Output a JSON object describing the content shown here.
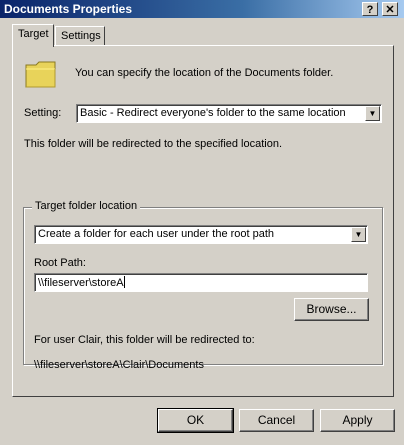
{
  "window": {
    "title": "Documents Properties",
    "help_label": "?",
    "close_label": "✕"
  },
  "tabs": [
    {
      "label": "Target"
    },
    {
      "label": "Settings"
    }
  ],
  "target": {
    "intro_text": "You can specify the location of the Documents folder.",
    "setting_label": "Setting:",
    "setting_value": "Basic - Redirect everyone's folder to the same location",
    "redirect_note": "This folder will be redirected to the specified location.",
    "group_title": "Target folder location",
    "location_value": "Create a folder for each user under the root path",
    "root_path_label": "Root Path:",
    "root_path_value": "\\\\fileserver\\storeA",
    "browse_label": "Browse...",
    "example_text": "For user Clair, this folder will be redirected to:",
    "example_path": "\\\\fileserver\\storeA\\Clair\\Documents"
  },
  "buttons": {
    "ok": "OK",
    "cancel": "Cancel",
    "apply": "Apply"
  }
}
